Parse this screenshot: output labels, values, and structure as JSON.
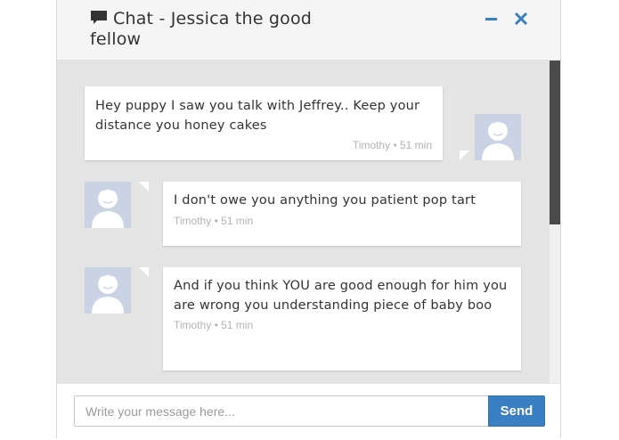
{
  "header": {
    "title": "Chat - Jessica the good fellow",
    "icons": {
      "chat": "chat-bubble-icon",
      "minimize": "minimize-icon",
      "close": "close-icon"
    },
    "accent_color": "#3a7fc1"
  },
  "messages": [
    {
      "text": "Hey puppy I saw you talk with Jeffrey.. Keep your distance you honey cakes",
      "meta": "Timothy • 51 min",
      "side": "right"
    },
    {
      "text": "I don't owe you anything you patient pop tart",
      "meta": "Timothy • 51 min",
      "side": "left"
    },
    {
      "text": "And if you think YOU are good enough for him you are wrong you understanding piece of baby boo",
      "meta": "Timothy • 51 min",
      "side": "left"
    }
  ],
  "footer": {
    "input_placeholder": "Write your message here...",
    "input_value": "",
    "send_label": "Send"
  }
}
